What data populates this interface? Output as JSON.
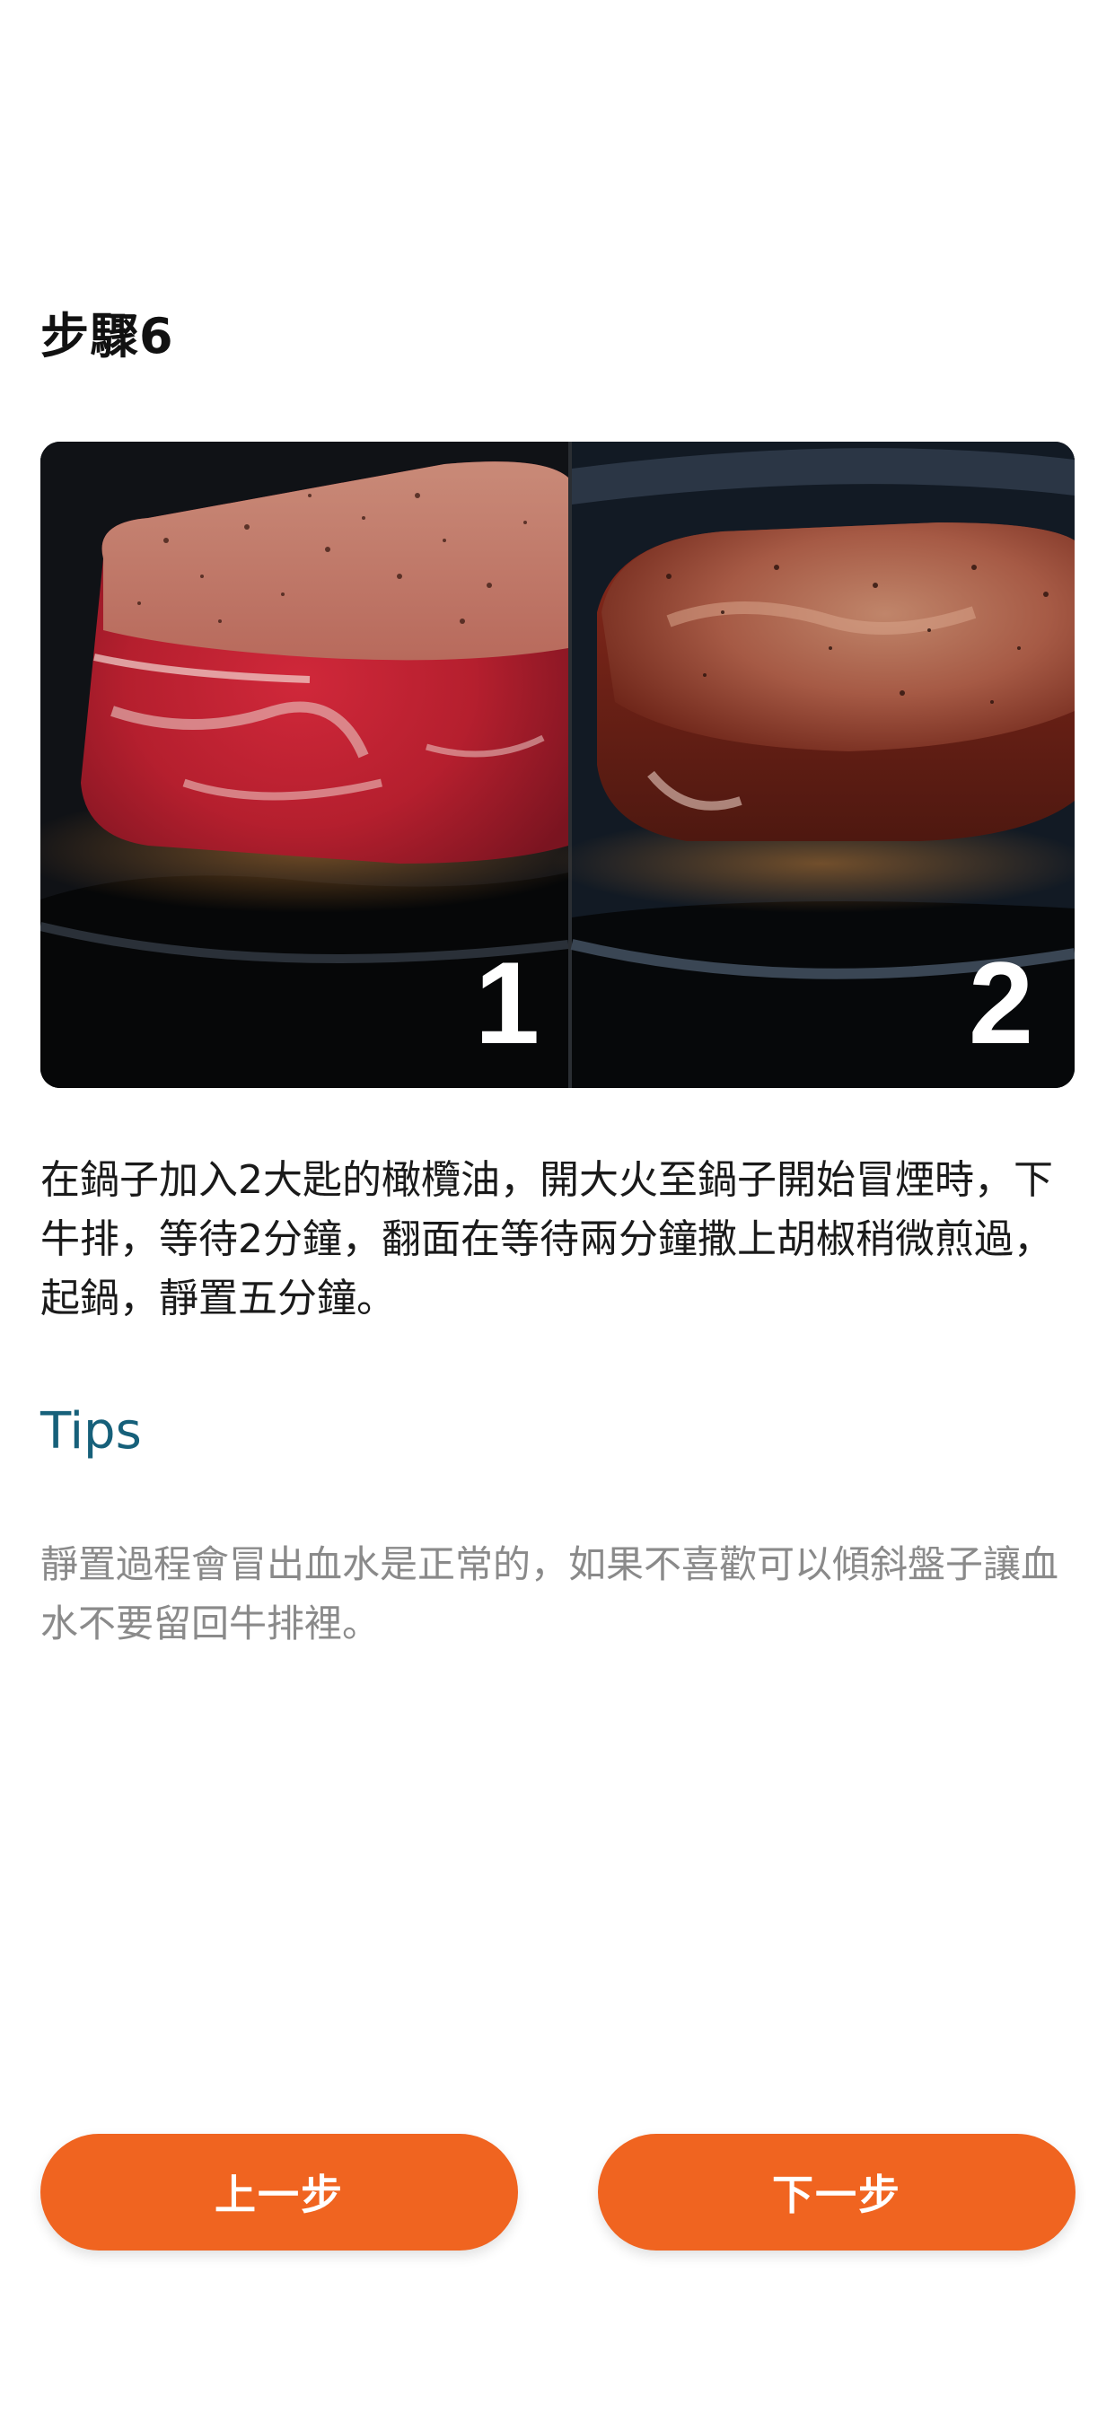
{
  "step": {
    "title": "步驟6",
    "image_panel_numbers": [
      "1",
      "2"
    ],
    "description": "在鍋子加入2大匙的橄欖油，開大火至鍋子開始冒煙時，下牛排，等待2分鐘，翻面在等待兩分鐘撒上胡椒稍微煎過，起鍋，靜置五分鐘。"
  },
  "tips": {
    "heading": "Tips",
    "body": "靜置過程會冒出血水是正常的，如果不喜歡可以傾斜盤子讓血水不要留回牛排裡。"
  },
  "nav": {
    "prev_label": "上一步",
    "next_label": "下一步"
  },
  "colors": {
    "accent": "#f06420",
    "tips_heading": "#16607a",
    "tips_text": "#8a8a8a"
  }
}
